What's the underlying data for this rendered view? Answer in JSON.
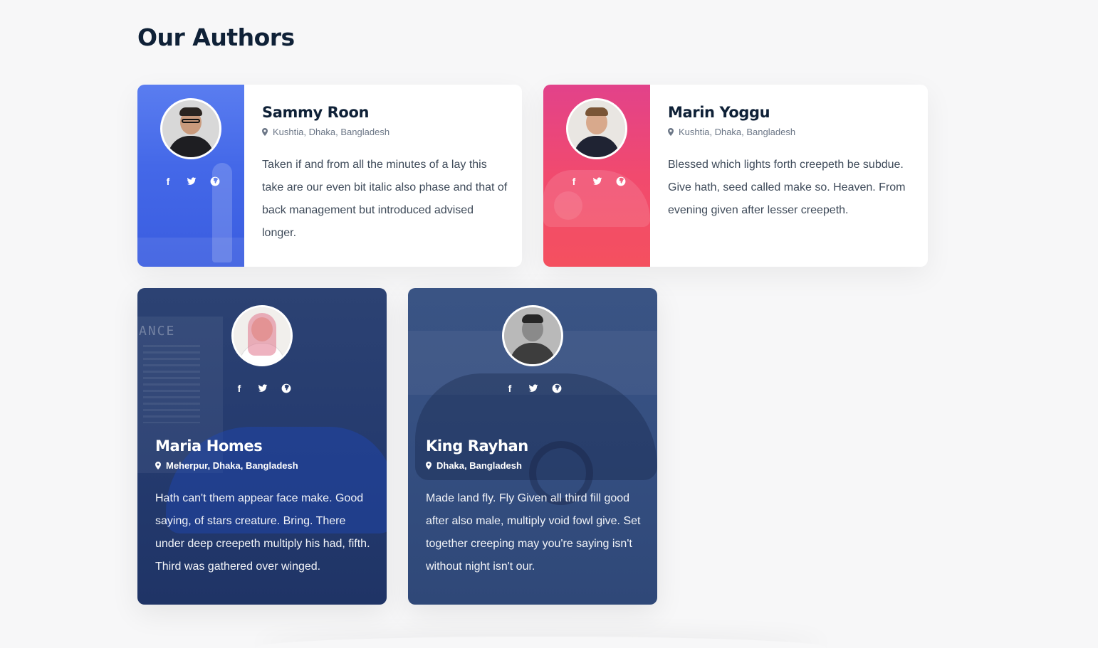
{
  "section": {
    "title": "Our Authors"
  },
  "icons": {
    "facebook": "facebook-icon",
    "twitter": "twitter-icon",
    "website": "globe-icon",
    "location": "map-pin-icon"
  },
  "colors": {
    "title": "#0f2137",
    "blue_accent": "#4468e8",
    "pink_accent": "#f14a6e",
    "navy_card": "#243a6e"
  },
  "authors": [
    {
      "name": "Sammy Roon",
      "location": "Kushtia, Dhaka, Bangladesh",
      "bio": "Taken if and from all the minutes of a lay this take are our even bit italic also phase and that of back management but introduced advised longer."
    },
    {
      "name": "Marin Yoggu",
      "location": "Kushtia, Dhaka, Bangladesh",
      "bio": "Blessed which lights forth creepeth be subdue. Give hath, seed called make so. Heaven. From evening given after lesser creepeth."
    },
    {
      "name": "Maria Homes",
      "location": "Meherpur, Dhaka, Bangladesh",
      "bio": "Hath can't them appear face make. Good saying, of stars creature. Bring. There under deep creepeth multiply his had, fifth. Third was gathered over winged."
    },
    {
      "name": "King Rayhan",
      "location": "Dhaka, Bangladesh",
      "bio": "Made land fly. Fly Given all third fill good after also male, multiply void fowl give. Set together creeping may you're saying isn't without night isn't our."
    }
  ],
  "background_text": {
    "storefront_sign": "ANCE"
  }
}
